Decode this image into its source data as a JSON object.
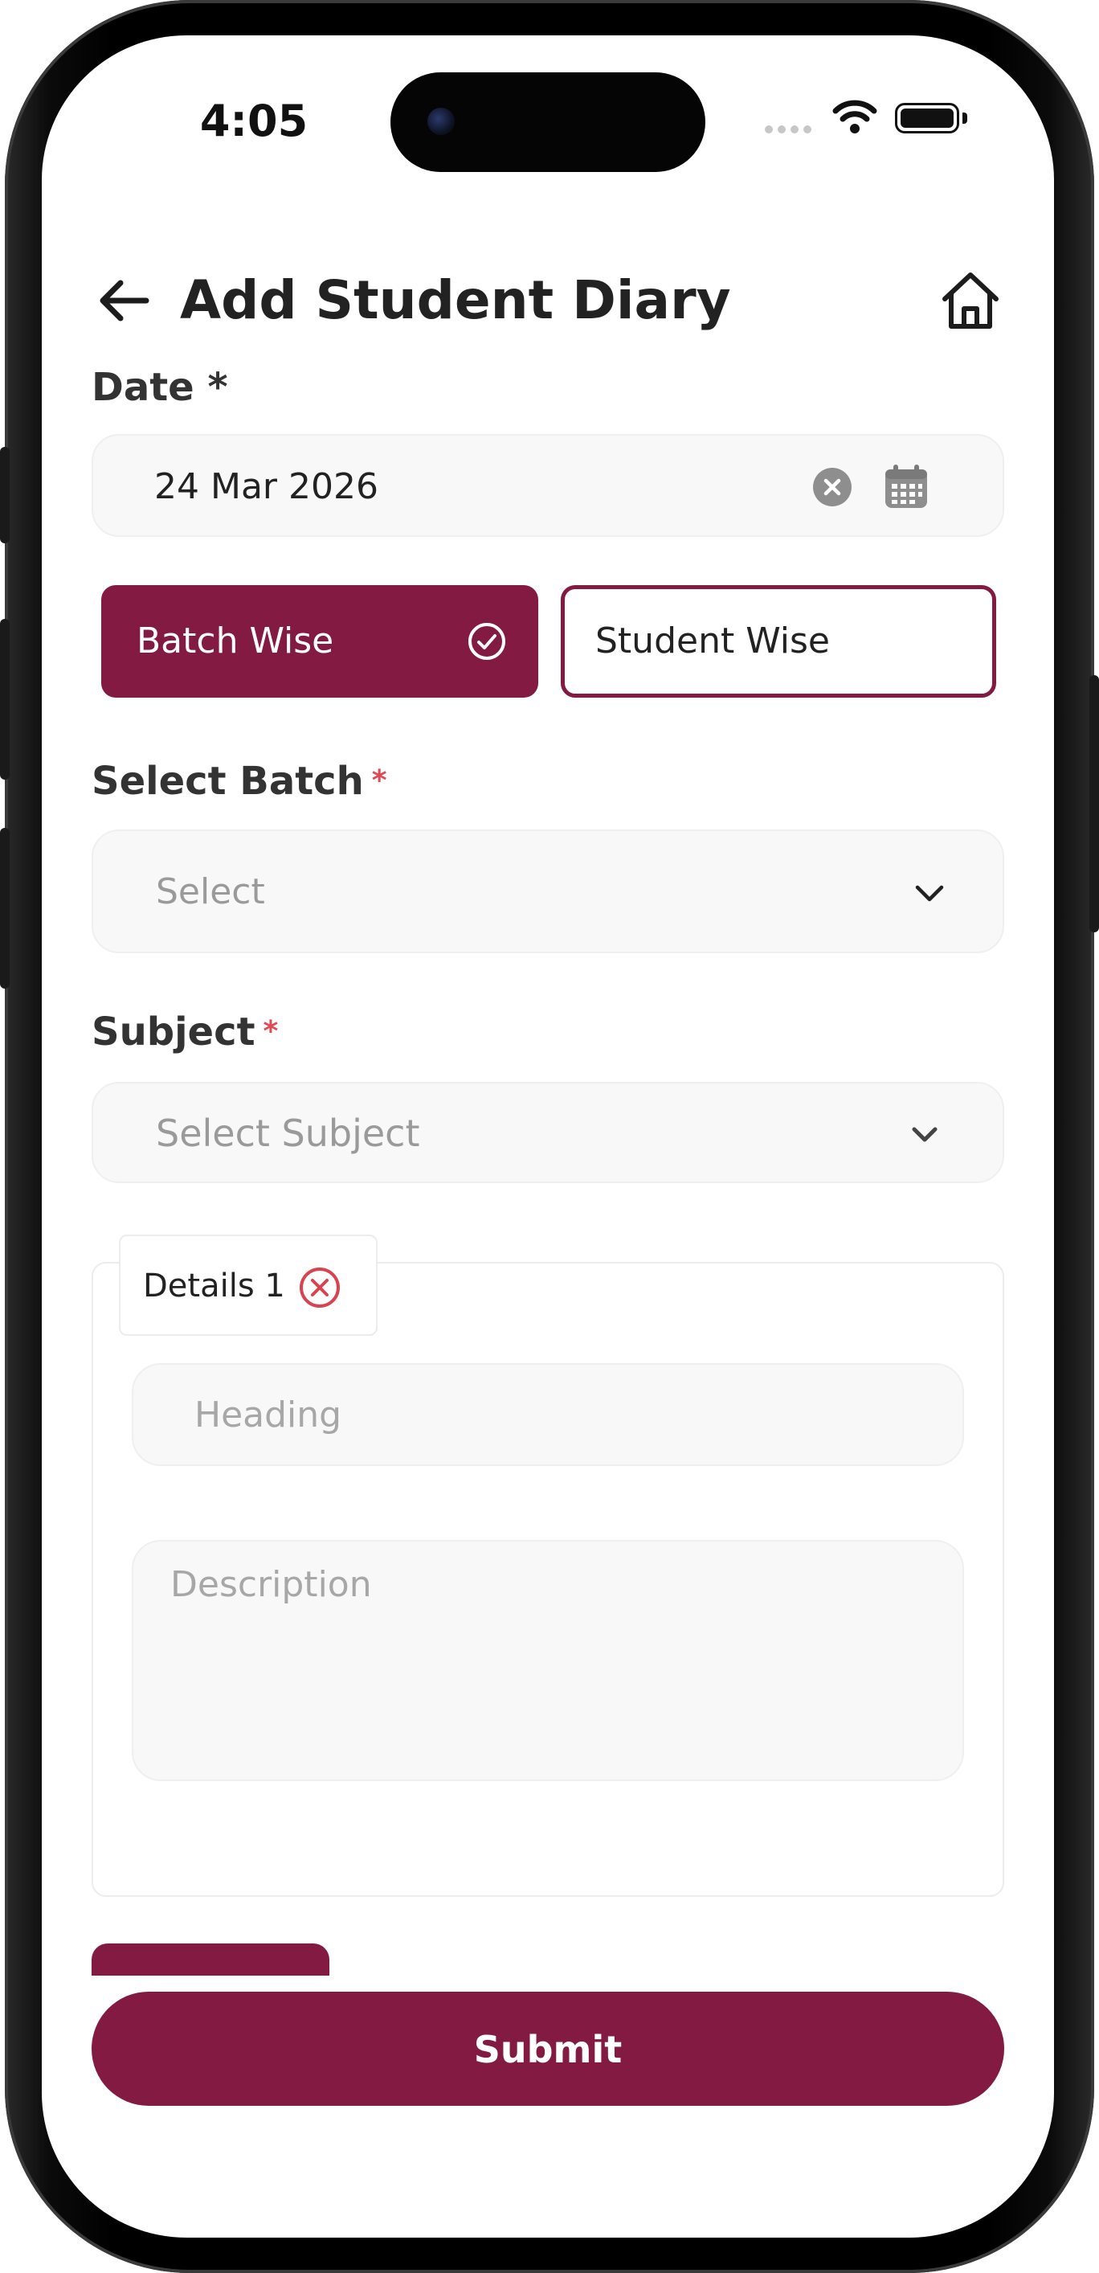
{
  "status_bar": {
    "time": "4:05"
  },
  "header": {
    "title": "Add Student Diary",
    "back_icon": "arrow-left-icon",
    "home_icon": "home-icon"
  },
  "date": {
    "label": "Date *",
    "value": "24 Mar 2026"
  },
  "mode_toggle": {
    "batch_wise": "Batch Wise",
    "student_wise": "Student Wise",
    "selected": "batch_wise"
  },
  "batch": {
    "label": "Select Batch",
    "required_mark": "*",
    "placeholder": "Select"
  },
  "subject": {
    "label": "Subject",
    "required_mark": "*",
    "placeholder": "Select Subject"
  },
  "details": [
    {
      "tab_label": "Details 1",
      "heading_placeholder": "Heading",
      "description_placeholder": "Description"
    }
  ],
  "submit": {
    "label": "Submit"
  },
  "colors": {
    "primary": "#821a42",
    "required": "#e04a55",
    "remove": "#d9434f",
    "field_bg": "#f8f8f8",
    "placeholder": "#9a9a9a"
  }
}
